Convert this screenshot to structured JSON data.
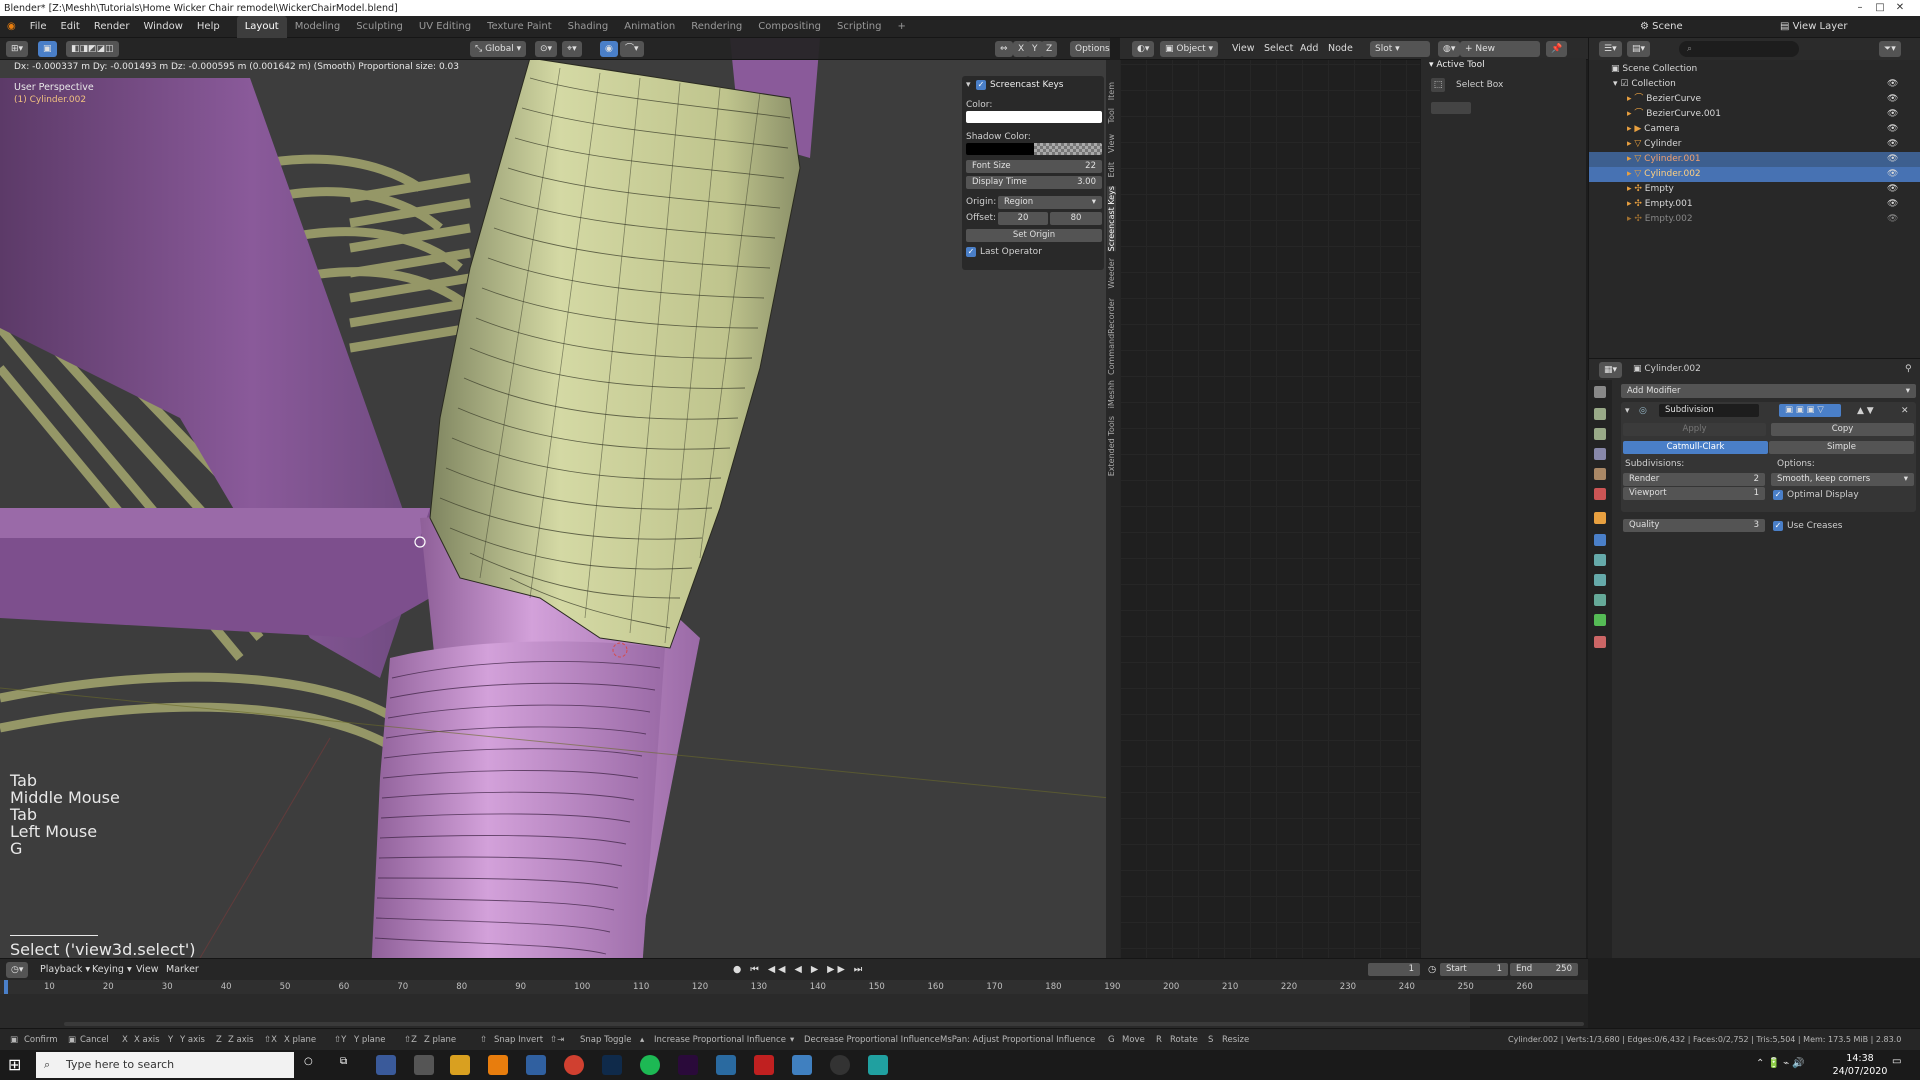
{
  "window": {
    "title": "Blender* [Z:\\Meshh\\Tutorials\\Home Wicker Chair remodel\\WickerChairModel.blend]"
  },
  "menu": {
    "items": [
      "File",
      "Edit",
      "Render",
      "Window",
      "Help"
    ]
  },
  "workspaces": [
    "Layout",
    "Modeling",
    "Sculpting",
    "UV Editing",
    "Texture Paint",
    "Shading",
    "Animation",
    "Rendering",
    "Compositing",
    "Scripting"
  ],
  "active_workspace": "Layout",
  "viewport": {
    "transform_info": "Dx: -0.000337 m  Dy: -0.001493 m  Dz: -0.000595 m (0.001642 m) (Smooth)   Proportional size: 0.03",
    "view_name": "User Perspective",
    "object_name": "(1) Cylinder.002",
    "orientation": "Global",
    "options_label": "Options",
    "axes": [
      "X",
      "Y",
      "Z"
    ],
    "screencast_keys": [
      "Tab",
      "Middle Mouse",
      "Tab",
      "Left Mouse",
      "G"
    ],
    "last_operator": "Select ('view3d.select')"
  },
  "screencast_panel": {
    "title": "Screencast Keys",
    "color_label": "Color:",
    "shadow_color_label": "Shadow Color:",
    "font_size_label": "Font Size",
    "font_size": "22",
    "display_time_label": "Display Time",
    "display_time": "3.00",
    "origin_label": "Origin:",
    "origin_value": "Region",
    "offset_label": "Offset:",
    "offset_x": "20",
    "offset_y": "80",
    "set_origin": "Set Origin",
    "last_operator": "Last Operator"
  },
  "side_tabs": [
    "Item",
    "Tool",
    "View",
    "Edit",
    "Screencast Keys",
    "Weeder",
    "CommandRecorder",
    "iMeshh",
    "Extended Tools"
  ],
  "node_header": {
    "object": "Object",
    "view": "View",
    "select": "Select",
    "add": "Add",
    "node": "Node",
    "slot": "Slot",
    "new": "New"
  },
  "tool_panel": {
    "title": "Active Tool",
    "tool": "Select Box"
  },
  "outliner": {
    "scene": "Scene",
    "view_layer": "View Layer",
    "root": "Scene Collection",
    "collection": "Collection",
    "items": [
      "BezierCurve",
      "BezierCurve.001",
      "Camera",
      "Cylinder",
      "Cylinder.001",
      "Cylinder.002",
      "Empty",
      "Empty.001",
      "Empty.002"
    ]
  },
  "properties": {
    "object": "Cylinder.002",
    "add_modifier": "Add Modifier",
    "modifier_name": "Subdivision",
    "apply": "Apply",
    "copy": "Copy",
    "mode_a": "Catmull-Clark",
    "mode_b": "Simple",
    "subdivisions_label": "Subdivisions:",
    "options_label": "Options:",
    "render_label": "Render",
    "render_value": "2",
    "viewport_label": "Viewport",
    "viewport_value": "1",
    "quality_label": "Quality",
    "quality_value": "3",
    "uv_smooth": "Smooth, keep corners",
    "optimal_display": "Optimal Display",
    "use_creases": "Use Creases"
  },
  "timeline": {
    "menus": [
      "Playback",
      "Keying",
      "View",
      "Marker"
    ],
    "current_frame": "1",
    "start_label": "Start",
    "start": "1",
    "end_label": "End",
    "end": "250",
    "ticks": [
      "10",
      "20",
      "30",
      "40",
      "50",
      "60",
      "70",
      "80",
      "90",
      "100",
      "110",
      "120",
      "130",
      "140",
      "150",
      "160",
      "170",
      "180",
      "190",
      "200",
      "210",
      "220",
      "230",
      "240",
      "250",
      "260"
    ]
  },
  "statusbar": {
    "hints": [
      "Confirm",
      "Cancel",
      "X axis",
      "Y axis",
      "Z axis",
      "X plane",
      "Y plane",
      "Z plane",
      "Snap Invert",
      "Snap Toggle",
      "Increase Proportional Influence",
      "Decrease Proportional Influence",
      "MsPan: Adjust Proportional Influence",
      "Move",
      "Rotate",
      "Resize"
    ],
    "stats": "Cylinder.002 | Verts:1/3,680 | Edges:0/6,432 | Faces:0/2,752 | Tris:5,504 | Mem: 173.5 MiB | 2.83.0"
  },
  "taskbar": {
    "search_placeholder": "Type here to search",
    "time": "14:38",
    "date": "24/07/2020"
  },
  "colors": {
    "accent": "#4a7fc8",
    "selection": "#3d5f8f",
    "viewport_bg": "#3d3d3d",
    "mesh_green": "#c7cc94",
    "mesh_pink": "#c08ec8",
    "mesh_purple": "#8a5a9a"
  }
}
